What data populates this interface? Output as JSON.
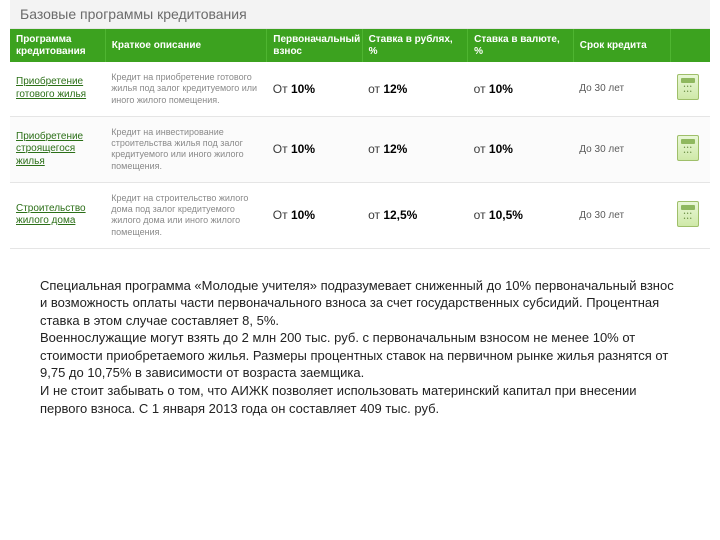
{
  "panel_title": "Базовые программы кредитования",
  "headers": {
    "program": "Программа кредитования",
    "desc": "Краткое описание",
    "down": "Первоначальный взнос",
    "rub": "Ставка в рублях, %",
    "val": "Ставка в валюте, %",
    "term": "Срок кредита"
  },
  "rows": [
    {
      "program": "Приобретение готового жилья",
      "desc": "Кредит на приобретение готового жилья под залог кредитуемого или иного жилого помещения.",
      "down_pre": "От ",
      "down_b": "10%",
      "rub_pre": "от ",
      "rub_b": "12%",
      "val_pre": "от ",
      "val_b": "10%",
      "term": "До 30 лет"
    },
    {
      "program": "Приобретение строящегося жилья",
      "desc": "Кредит на инвестирование строительства жилья под залог кредитуемого или иного жилого помещения.",
      "down_pre": "От ",
      "down_b": "10%",
      "rub_pre": "от ",
      "rub_b": "12%",
      "val_pre": "от ",
      "val_b": "10%",
      "term": "До 30 лет"
    },
    {
      "program": "Строительство жилого дома",
      "desc": "Кредит на строительство жилого дома под залог кредитуемого жилого дома или иного жилого помещения.",
      "down_pre": "От ",
      "down_b": "10%",
      "rub_pre": "от ",
      "rub_b": "12,5%",
      "val_pre": "от ",
      "val_b": "10,5%",
      "term": "До 30 лет"
    }
  ],
  "paragraphs": [
    "Специальная программа «Молодые учителя» подразумевает сниженный до 10% первоначальный взнос и возможность оплаты части первоначального взноса за счет государственных субсидий. Процентная ставка в этом случае составляет 8, 5%.",
    "Военнослужащие могут взять до 2 млн 200 тыс. руб. с первоначальным взносом не менее 10% от стоимости приобретаемого жилья. Размеры процентных ставок на первичном рынке жилья разнятся от 9,75 до 10,75% в зависимости от возраста заемщика.",
    "И не стоит забывать о том, что АИЖК позволяет использовать материнский капитал при внесении первого взноса. С 1 января 2013 года он составляет 409 тыс. руб."
  ]
}
